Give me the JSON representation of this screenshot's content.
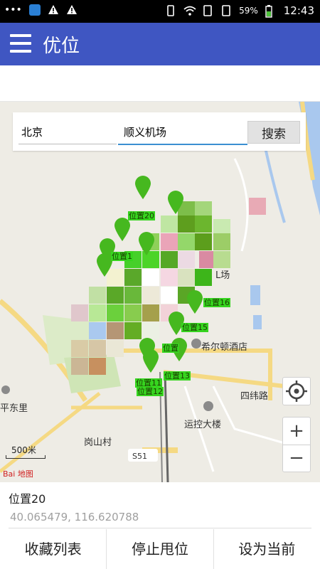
{
  "status_bar": {
    "dots": "•••",
    "battery": "59%",
    "time": "12:43"
  },
  "app": {
    "title": "优位"
  },
  "search": {
    "city_value": "北京",
    "place_value": "顺义机场",
    "button_label": "搜索"
  },
  "map": {
    "labels": [
      "希尔顿酒店",
      "运控大楼",
      "岗山村",
      "四纬路",
      "S51",
      "平东里",
      "L场"
    ],
    "scale": "500米",
    "logo": "Bai 地图",
    "pins": [
      "位置20",
      "位置1",
      "位置16",
      "位置15",
      "位置",
      "位置11",
      "位置13",
      "位置12"
    ]
  },
  "info": {
    "place_name": "位置20",
    "coordinates": "40.065479, 116.620788"
  },
  "actions": {
    "favorites": "收藏列表",
    "stop_moving": "停止甩位",
    "set_current": "设为当前"
  },
  "colors": {
    "app_bar": "#3f56c2",
    "pin": "#46b81f",
    "pin_label_bg": "#36d41f",
    "input_focus": "#3a8fd1"
  }
}
